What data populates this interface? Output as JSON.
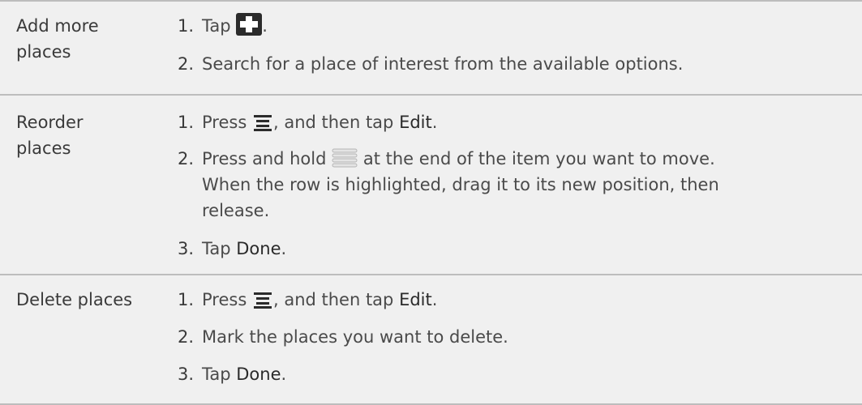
{
  "rows": [
    {
      "label": [
        "Add more",
        "places"
      ],
      "steps": [
        {
          "num": "1.",
          "before": "Tap",
          "icon": "plus-icon",
          "after": "."
        },
        {
          "num": "2.",
          "text": "Search for a place of interest from the available options."
        }
      ]
    },
    {
      "label": [
        "Reorder",
        "places"
      ],
      "steps": [
        {
          "num": "1.",
          "before": "Press",
          "icon": "menu-icon",
          "after": ", and then tap",
          "bold": "Edit",
          "end": "."
        },
        {
          "num": "2.",
          "lines": [
            "Press and hold",
            "at the end of the item you want to move.",
            "When the row is highlighted, drag it to its new position, then",
            "release."
          ],
          "icon": "drag-handle-icon"
        },
        {
          "num": "3.",
          "before": "Tap",
          "bold": "Done",
          "end": "."
        }
      ]
    },
    {
      "label": [
        "Delete places"
      ],
      "steps": [
        {
          "num": "1.",
          "before": "Press",
          "icon": "menu-icon",
          "after": ", and then tap",
          "bold": "Edit",
          "end": "."
        },
        {
          "num": "2.",
          "text": "Mark the places you want to delete."
        },
        {
          "num": "3.",
          "before": "Tap",
          "bold": "Done",
          "end": "."
        }
      ]
    }
  ]
}
